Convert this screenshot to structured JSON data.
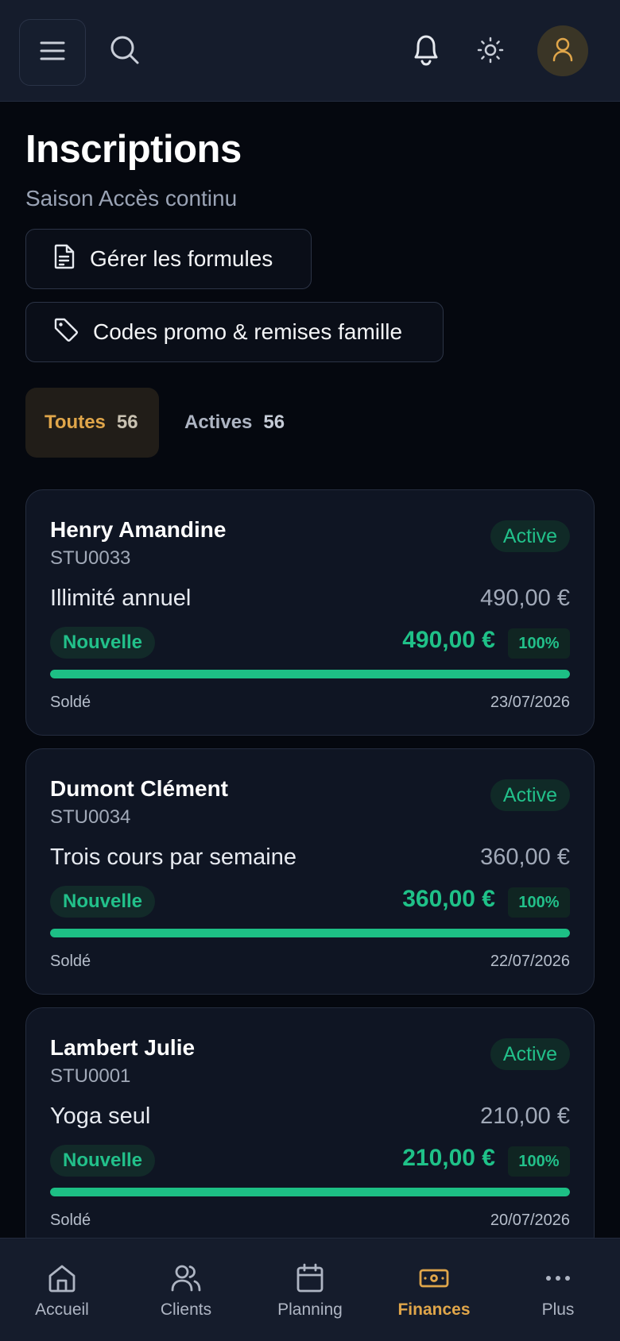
{
  "header": {
    "menu_icon": "hamburger-icon",
    "search_icon": "search-icon",
    "bell_icon": "bell-icon",
    "theme_icon": "sun-icon",
    "avatar_icon": "user-icon"
  },
  "page": {
    "title": "Inscriptions",
    "subtitle": "Saison Accès continu",
    "manage_button": "Gérer les formules",
    "promo_button": "Codes promo & remises famille"
  },
  "tabs": [
    {
      "label": "Toutes",
      "count": "56",
      "selected": true
    },
    {
      "label": "Actives",
      "count": "56",
      "selected": false
    }
  ],
  "cards": [
    {
      "name": "Henry Amandine",
      "id": "STU0033",
      "status": "Active",
      "plan": "Illimité annuel",
      "price": "490,00 €",
      "type": "Nouvelle",
      "paid": "490,00 €",
      "percent": "100%",
      "progress": 1.0,
      "paid_label": "Soldé",
      "date": "23/07/2026"
    },
    {
      "name": "Dumont Clément",
      "id": "STU0034",
      "status": "Active",
      "plan": "Trois cours par semaine",
      "price": "360,00 €",
      "type": "Nouvelle",
      "paid": "360,00 €",
      "percent": "100%",
      "progress": 1.0,
      "paid_label": "Soldé",
      "date": "22/07/2026"
    },
    {
      "name": "Lambert Julie",
      "id": "STU0001",
      "status": "Active",
      "plan": "Yoga seul",
      "price": "210,00 €",
      "type": "Nouvelle",
      "paid": "210,00 €",
      "percent": "100%",
      "progress": 1.0,
      "paid_label": "Soldé",
      "date": "20/07/2026"
    }
  ],
  "nav": [
    {
      "label": "Accueil",
      "icon": "home-icon",
      "current": false
    },
    {
      "label": "Clients",
      "icon": "users-icon",
      "current": false
    },
    {
      "label": "Planning",
      "icon": "calendar-icon",
      "current": false
    },
    {
      "label": "Finances",
      "icon": "banknote-icon",
      "current": true
    },
    {
      "label": "Plus",
      "icon": "more-icon",
      "current": false
    }
  ],
  "colors": {
    "accent": "#e0a64a",
    "success": "#1fc188",
    "background": "#05080f",
    "surface": "#0f1523"
  }
}
